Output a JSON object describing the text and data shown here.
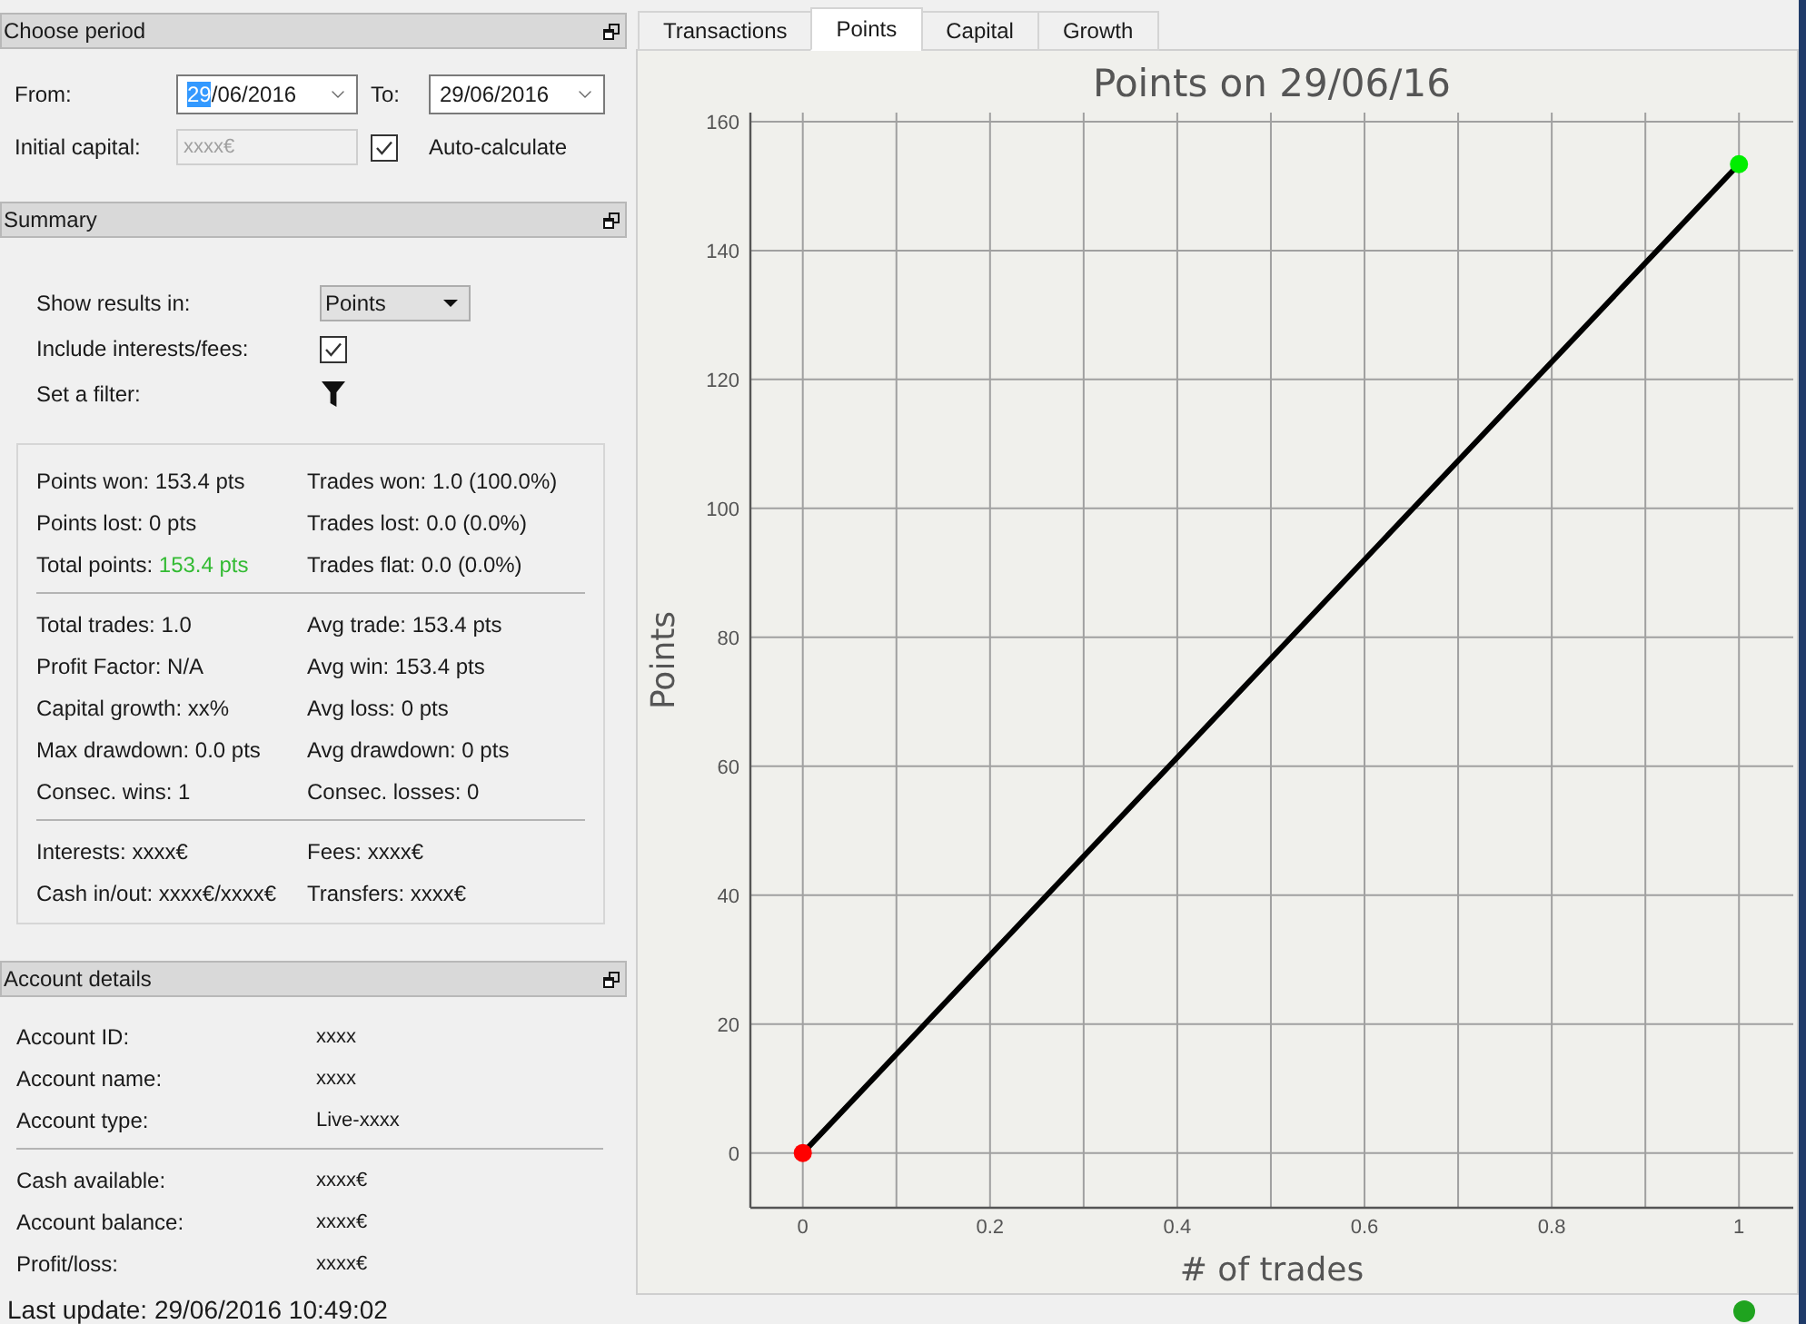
{
  "period_panel": {
    "title": "Choose period",
    "from": {
      "label": "From:",
      "segments": [
        {
          "text": "29",
          "selected": true
        },
        {
          "text": "/06/2016",
          "selected": false
        }
      ]
    },
    "to": {
      "label": "To:",
      "segments": [
        {
          "text": "29/06/2016",
          "selected": false
        }
      ]
    },
    "initial_capital": {
      "label": "Initial capital:",
      "value": "xxxx€",
      "disabled": true
    },
    "auto_calculate": {
      "label": "Auto-calculate",
      "checked": true
    }
  },
  "summary_panel": {
    "title": "Summary",
    "show_results": {
      "label": "Show results in:",
      "value": "Points"
    },
    "include_fees": {
      "label": "Include interests/fees:",
      "checked": true
    },
    "filter": {
      "label": "Set a filter:"
    },
    "stat_groups": [
      {
        "rows": [
          [
            {
              "label": "Points won:",
              "value": "153.4 pts"
            },
            {
              "label": "Trades won:",
              "value": "1.0 (100.0%)"
            }
          ],
          [
            {
              "label": "Points lost:",
              "value": "0 pts"
            },
            {
              "label": "Trades lost:",
              "value": "0.0 (0.0%)"
            }
          ],
          [
            {
              "label": "Total points:",
              "value": "153.4 pts",
              "color": "#33bb33"
            },
            {
              "label": "Trades flat:",
              "value": "0.0 (0.0%)"
            }
          ]
        ]
      },
      {
        "rows": [
          [
            {
              "label": "Total trades:",
              "value": "1.0"
            },
            {
              "label": "Avg trade:",
              "value": "153.4 pts"
            }
          ],
          [
            {
              "label": "Profit Factor:",
              "value": "N/A"
            },
            {
              "label": "Avg win:",
              "value": "153.4 pts"
            }
          ],
          [
            {
              "label": "Capital growth:",
              "value": "xx%"
            },
            {
              "label": "Avg loss:",
              "value": "0 pts"
            }
          ],
          [
            {
              "label": "Max drawdown:",
              "value": "0.0 pts"
            },
            {
              "label": "Avg drawdown:",
              "value": "0 pts"
            }
          ],
          [
            {
              "label": "Consec. wins:",
              "value": "1"
            },
            {
              "label": "Consec. losses:",
              "value": "0"
            }
          ]
        ]
      },
      {
        "rows": [
          [
            {
              "label": "Interests:",
              "value": "xxxx€"
            },
            {
              "label": "Fees:",
              "value": "xxxx€"
            }
          ],
          [
            {
              "label": "Cash in/out:",
              "value": "xxxx€/xxxx€"
            },
            {
              "label": "Transfers:",
              "value": "xxxx€"
            }
          ]
        ]
      }
    ]
  },
  "account_panel": {
    "title": "Account details",
    "groups": [
      [
        {
          "label": "Account ID:",
          "value": "xxxx"
        },
        {
          "label": "Account name:",
          "value": "xxxx"
        },
        {
          "label": "Account type:",
          "value": "Live-xxxx"
        }
      ],
      [
        {
          "label": "Cash available:",
          "value": "xxxx€"
        },
        {
          "label": "Account balance:",
          "value": "xxxx€"
        },
        {
          "label": "Profit/loss:",
          "value": "xxxx€"
        }
      ]
    ]
  },
  "tabs": [
    {
      "label": "Transactions",
      "selected": false
    },
    {
      "label": "Points",
      "selected": true
    },
    {
      "label": "Capital",
      "selected": false
    },
    {
      "label": "Growth",
      "selected": false
    }
  ],
  "points_chart": {
    "chart_data": {
      "type": "line",
      "title": "Points on 29/06/16",
      "xlabel": "# of trades",
      "ylabel": "Points",
      "x": [
        0,
        1
      ],
      "series": [
        {
          "color": "#000000",
          "values": [
            0,
            153.4
          ],
          "marker": true
        }
      ],
      "xlim": [
        -0.056,
        1.058
      ],
      "ylim": [
        -8.5,
        161.4
      ],
      "xticks": [
        0,
        0.2,
        0.4,
        0.6,
        0.8,
        1
      ],
      "yticks": [
        0,
        20,
        40,
        60,
        80,
        100,
        120,
        140,
        160
      ],
      "grid": true
    },
    "markers": [
      {
        "color": "#ff0000"
      },
      {
        "color": "#00ee00"
      }
    ]
  },
  "status_bar": {
    "text": "Last update: 29/06/2016 10:49:02",
    "connected": true
  }
}
